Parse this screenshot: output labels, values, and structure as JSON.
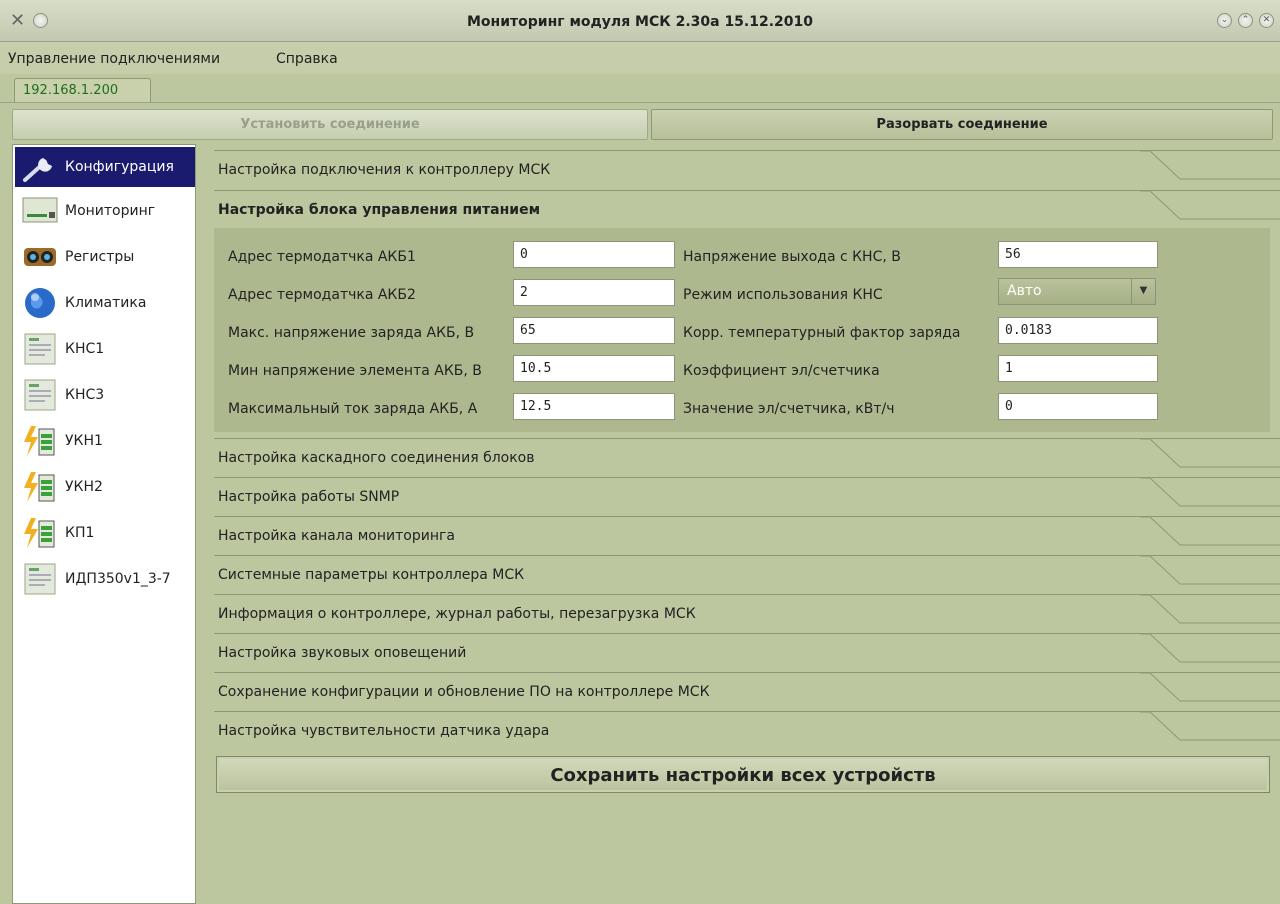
{
  "window": {
    "title": "Мониторинг модуля МСК 2.30а 15.12.2010"
  },
  "menu": [
    "Управление подключениями",
    "Справка"
  ],
  "connection_tab": "192.168.1.200",
  "buttons": {
    "connect": "Установить соединение",
    "disconnect": "Разорвать соединение",
    "save_all": "Сохранить настройки всех устройств"
  },
  "sidebar": {
    "items": [
      {
        "label": "Конфигурация",
        "icon": "wrench-icon",
        "active": true
      },
      {
        "label": "Мониторинг",
        "icon": "monitoring-icon"
      },
      {
        "label": "Регистры",
        "icon": "registers-icon"
      },
      {
        "label": "Климатика",
        "icon": "globe-icon"
      },
      {
        "label": "КНС1",
        "icon": "device-icon"
      },
      {
        "label": "КНС3",
        "icon": "device-icon"
      },
      {
        "label": "УКН1",
        "icon": "battery-icon"
      },
      {
        "label": "УКН2",
        "icon": "battery-icon"
      },
      {
        "label": "КП1",
        "icon": "battery-icon"
      },
      {
        "label": "ИДП350v1_3-7",
        "icon": "device-icon"
      }
    ]
  },
  "sections": {
    "s0": "Настройка подключения к контроллеру МСК",
    "s1": "Настройка блока управления питанием",
    "s2": "Настройка каскадного соединения блоков",
    "s3": "Настройка работы SNMP",
    "s4": "Настройка канала мониторинга",
    "s5": "Системные параметры контроллера МСК",
    "s6": "Информация о контроллере, журнал работы, перезагрузка МСК",
    "s7": "Настройка звуковых оповещений",
    "s8": "Сохранение конфигурации и обновление ПО на контроллере МСК",
    "s9": "Настройка чувствительности датчика удара"
  },
  "form": {
    "left": [
      {
        "label": "Адрес термодатчка АКБ1",
        "value": "0"
      },
      {
        "label": "Адрес термодатчка АКБ2",
        "value": "2"
      },
      {
        "label": "Макс. напряжение заряда АКБ, В",
        "value": "65"
      },
      {
        "label": "Мин напряжение элемента АКБ, В",
        "value": "10.5"
      },
      {
        "label": "Максимальный ток заряда АКБ, А",
        "value": "12.5"
      }
    ],
    "right": [
      {
        "label": "Напряжение выхода с КНС, В",
        "value": "56"
      },
      {
        "label": "Режим использования КНС",
        "value": "Авто"
      },
      {
        "label": "Корр. температурный фактор заряда",
        "value": "0.0183"
      },
      {
        "label": "Коэффициент эл/счетчика",
        "value": "1"
      },
      {
        "label": "Значение эл/счетчика, кВт/ч",
        "value": "0"
      }
    ]
  },
  "colors": {
    "background": "#bcc7a0",
    "panel": "#aeb88f",
    "active_nav": "#1a1a6e",
    "tab_text": "#1f6e1f"
  }
}
